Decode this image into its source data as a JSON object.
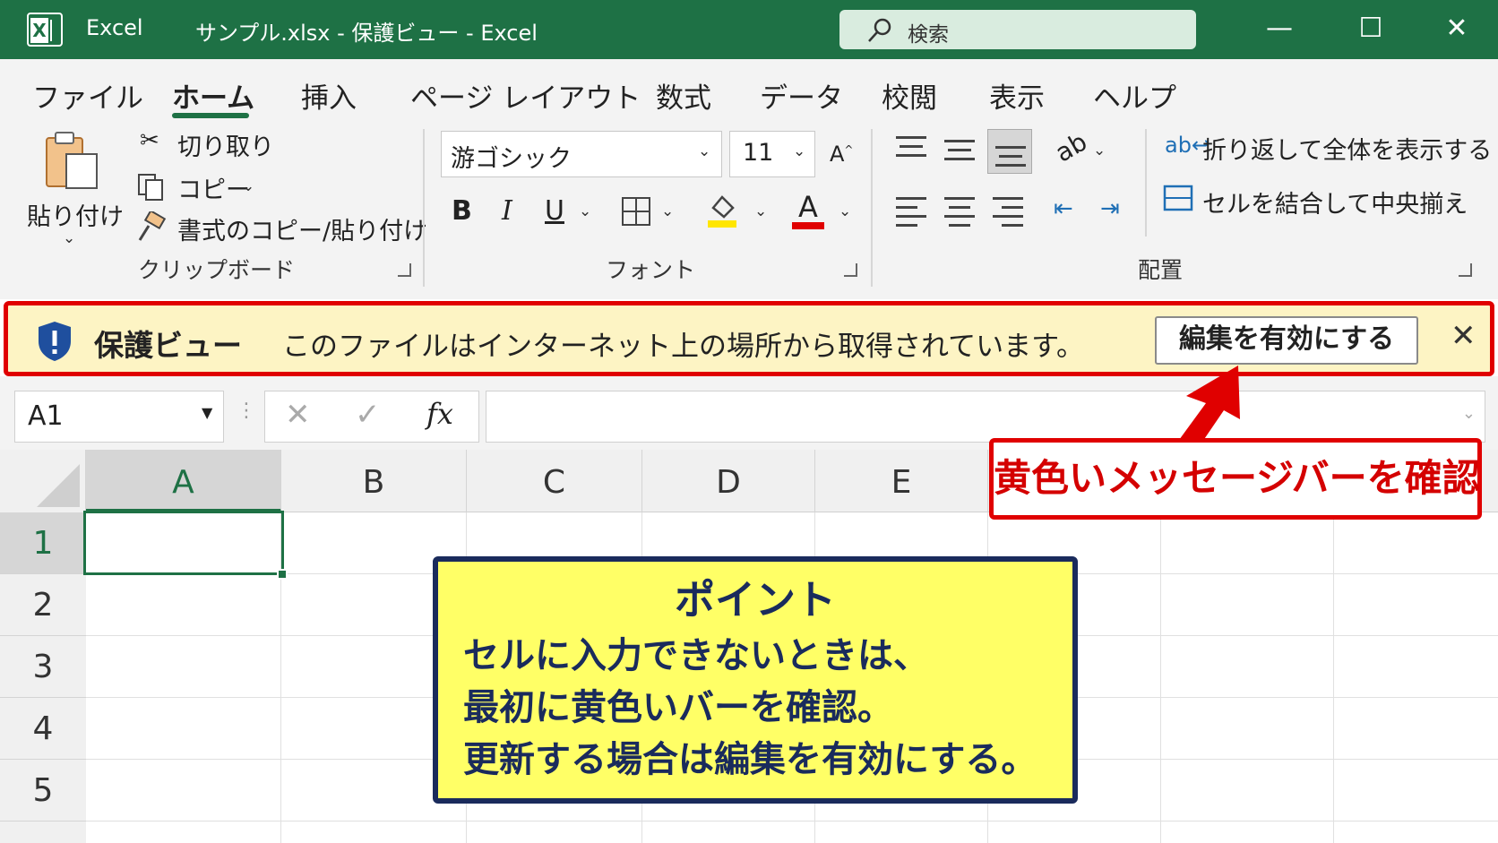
{
  "window": {
    "app_name": "Excel",
    "doc_title": "サンプル.xlsx - 保護ビュー - Excel",
    "search_placeholder": "検索",
    "minimize": "—",
    "maximize": "☐",
    "close": "✕"
  },
  "menu": {
    "tabs": [
      {
        "label": "ファイル"
      },
      {
        "label": "ホーム",
        "active": true
      },
      {
        "label": "挿入"
      },
      {
        "label": "ページ レイアウト"
      },
      {
        "label": "数式"
      },
      {
        "label": "データ"
      },
      {
        "label": "校閲"
      },
      {
        "label": "表示"
      },
      {
        "label": "ヘルプ"
      }
    ]
  },
  "ribbon": {
    "clipboard": {
      "paste_label": "貼り付け",
      "cut_label": "切り取り",
      "copy_label": "コピー",
      "format_painter_label": "書式のコピー/貼り付け",
      "group_label": "クリップボード"
    },
    "font": {
      "font_name": "游ゴシック",
      "font_size": "11",
      "bold": "B",
      "italic": "I",
      "underline": "U",
      "font_color_letter": "A",
      "grow_font": "A",
      "group_label": "フォント",
      "highlight_color": "#ffe600",
      "font_color": "#e00000"
    },
    "alignment": {
      "wrap_text_label": "折り返して全体を表示する",
      "merge_center_label": "セルを結合して中央揃え",
      "group_label": "配置"
    }
  },
  "message_bar": {
    "title": "保護ビュー",
    "message": "このファイルはインターネット上の場所から取得されています。",
    "enable_button": "編集を有効にする",
    "close": "✕"
  },
  "formula_bar": {
    "name_box": "A1",
    "cancel": "✕",
    "enter": "✓",
    "fx": "fx",
    "value": ""
  },
  "sheet": {
    "columns": [
      "A",
      "B",
      "C",
      "D",
      "E"
    ],
    "rows": [
      "1",
      "2",
      "3",
      "4",
      "5"
    ],
    "selected_cell": "A1"
  },
  "annotations": {
    "callout": "黄色いメッセージバーを確認",
    "point": {
      "title": "ポイント",
      "lines": [
        "セルに入力できないときは、",
        "最初に黄色いバーを確認。",
        "更新する場合は編集を有効にする。"
      ]
    }
  },
  "colors": {
    "excel_green": "#1e7145",
    "message_bar_bg": "#fdf4c4",
    "highlight_red": "#e00000",
    "point_box_bg": "#ffff66",
    "point_box_border": "#1a2b5c"
  }
}
